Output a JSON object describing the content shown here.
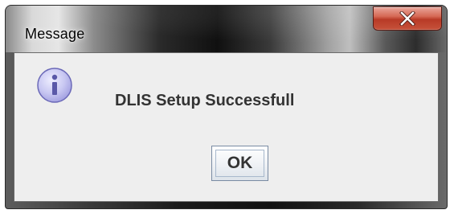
{
  "window": {
    "title": "Message",
    "close_icon": "close-x-icon"
  },
  "dialog": {
    "icon": "info-icon",
    "message": "DLIS Setup Successfull",
    "ok_label": "OK"
  },
  "colors": {
    "close_button": "#c6523b",
    "content_bg": "#eeeeee",
    "info_icon_fill": "#c9c8f2"
  }
}
